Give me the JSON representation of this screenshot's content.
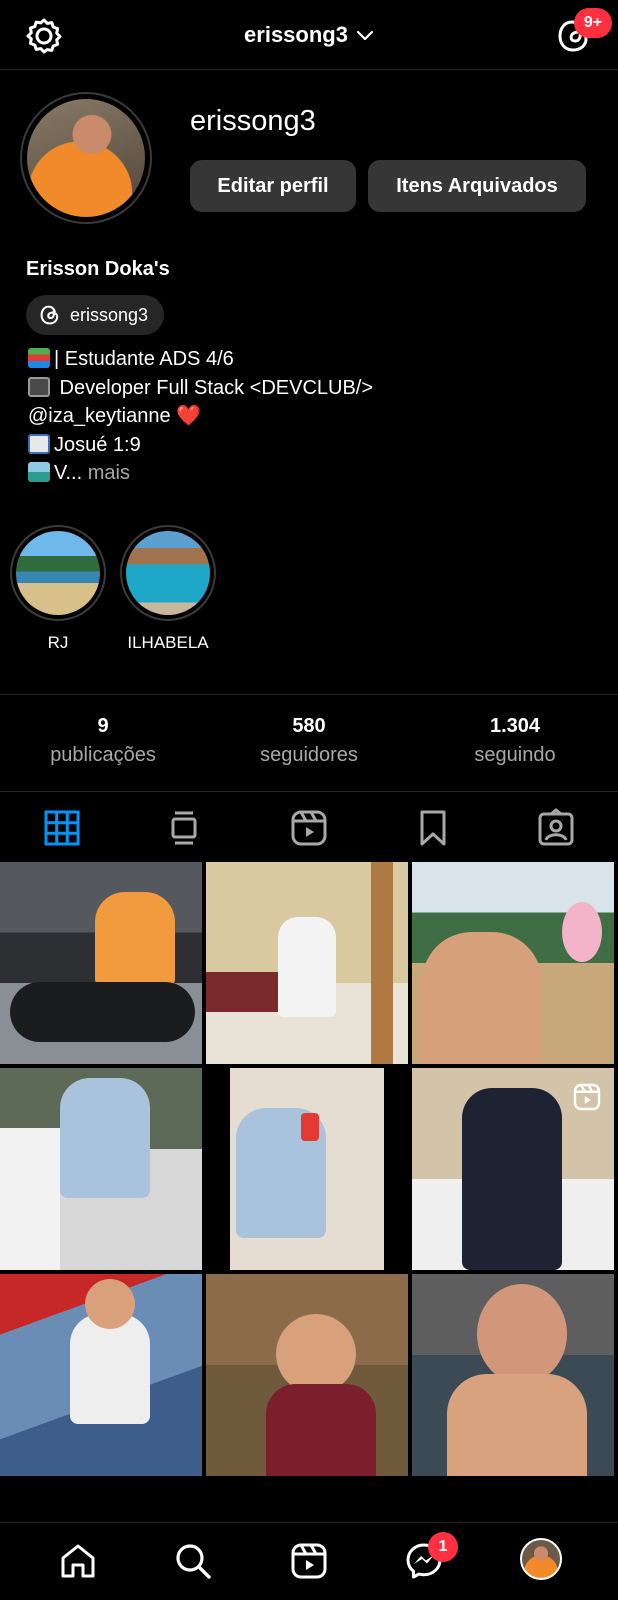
{
  "header": {
    "username": "erissong3",
    "notification_badge": "9+"
  },
  "profile": {
    "username": "erissong3",
    "edit_button": "Editar perfil",
    "archive_button": "Itens Arquivados",
    "full_name": "Erisson Doka's",
    "threads_handle": "erissong3",
    "bio": [
      "| Estudante ADS 4/6",
      " Developer Full Stack <DEVCLUB/>",
      "@iza_keytianne ❤️",
      "Josué 1:9",
      "V..."
    ],
    "bio_more": " mais"
  },
  "highlights": [
    {
      "label": "RJ"
    },
    {
      "label": "ILHABELA"
    }
  ],
  "stats": [
    {
      "value": "9",
      "label": "publicações"
    },
    {
      "value": "580",
      "label": "seguidores"
    },
    {
      "value": "1.304",
      "label": "seguindo"
    }
  ],
  "tabs": [
    "grid-icon",
    "feed-icon",
    "reels-icon",
    "saved-icon",
    "tagged-icon"
  ],
  "grid_posts": [
    {
      "kind": "photo",
      "is_reel": false
    },
    {
      "kind": "photo",
      "is_reel": false
    },
    {
      "kind": "photo",
      "is_reel": false
    },
    {
      "kind": "photo",
      "is_reel": false
    },
    {
      "kind": "photo",
      "is_reel": false
    },
    {
      "kind": "photo",
      "is_reel": true
    },
    {
      "kind": "photo",
      "is_reel": false
    },
    {
      "kind": "photo",
      "is_reel": false
    },
    {
      "kind": "photo",
      "is_reel": false
    }
  ],
  "bottom_nav": {
    "messages_badge": "1"
  },
  "colors": {
    "accent": "#0095f6",
    "badge": "#ff3040",
    "muted": "#a8a8a8",
    "button": "#363636"
  }
}
